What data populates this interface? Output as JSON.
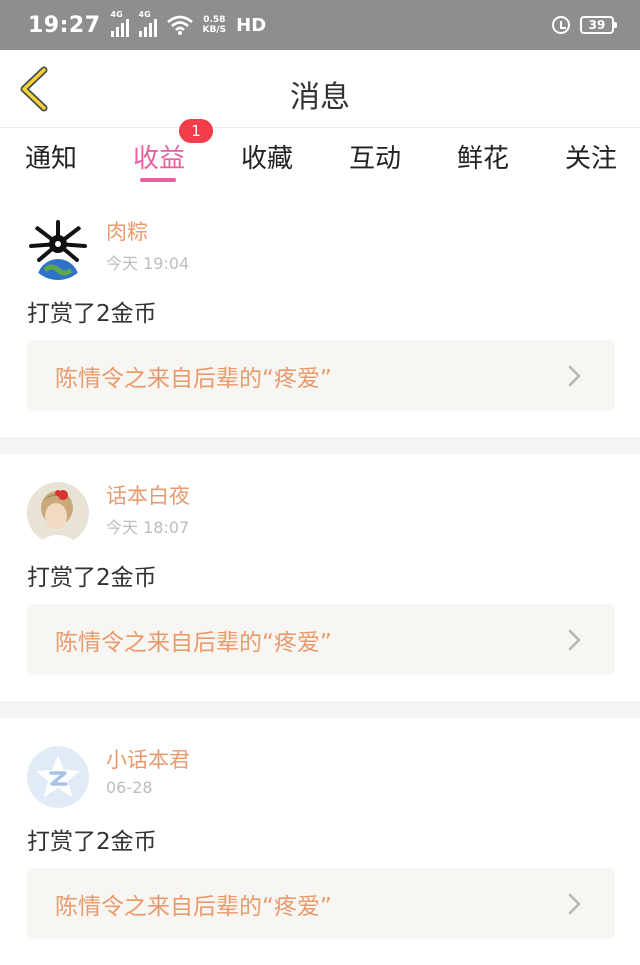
{
  "status_bar": {
    "time": "19:27",
    "network_1": "4G",
    "network_2": "4G",
    "speed_value": "0.58",
    "speed_unit": "KB/S",
    "hd": "HD",
    "battery": "39"
  },
  "header": {
    "title": "消息"
  },
  "tabs": [
    {
      "label": "通知"
    },
    {
      "label": "收益",
      "badge": "1"
    },
    {
      "label": "收藏"
    },
    {
      "label": "互动"
    },
    {
      "label": "鲜花"
    },
    {
      "label": "关注"
    }
  ],
  "colors": {
    "accent_pink": "#e8609e",
    "name_orange": "#ea9a6c",
    "badge_red": "#f23d4c"
  },
  "messages": [
    {
      "user": "肉粽",
      "time": "今天 19:04",
      "text": "打赏了2金币",
      "book": "陈情令之来自后辈的“疼爱”",
      "avatar_icon": "dragon-globe-avatar"
    },
    {
      "user": "话本白夜",
      "time": "今天 18:07",
      "text": "打赏了2金币",
      "book": "陈情令之来自后辈的“疼爱”",
      "avatar_icon": "girl-photo-avatar"
    },
    {
      "user": "小话本君",
      "time": "06-28",
      "text": "打赏了2金币",
      "book": "陈情令之来自后辈的“疼爱”",
      "avatar_icon": "z-star-avatar"
    }
  ]
}
